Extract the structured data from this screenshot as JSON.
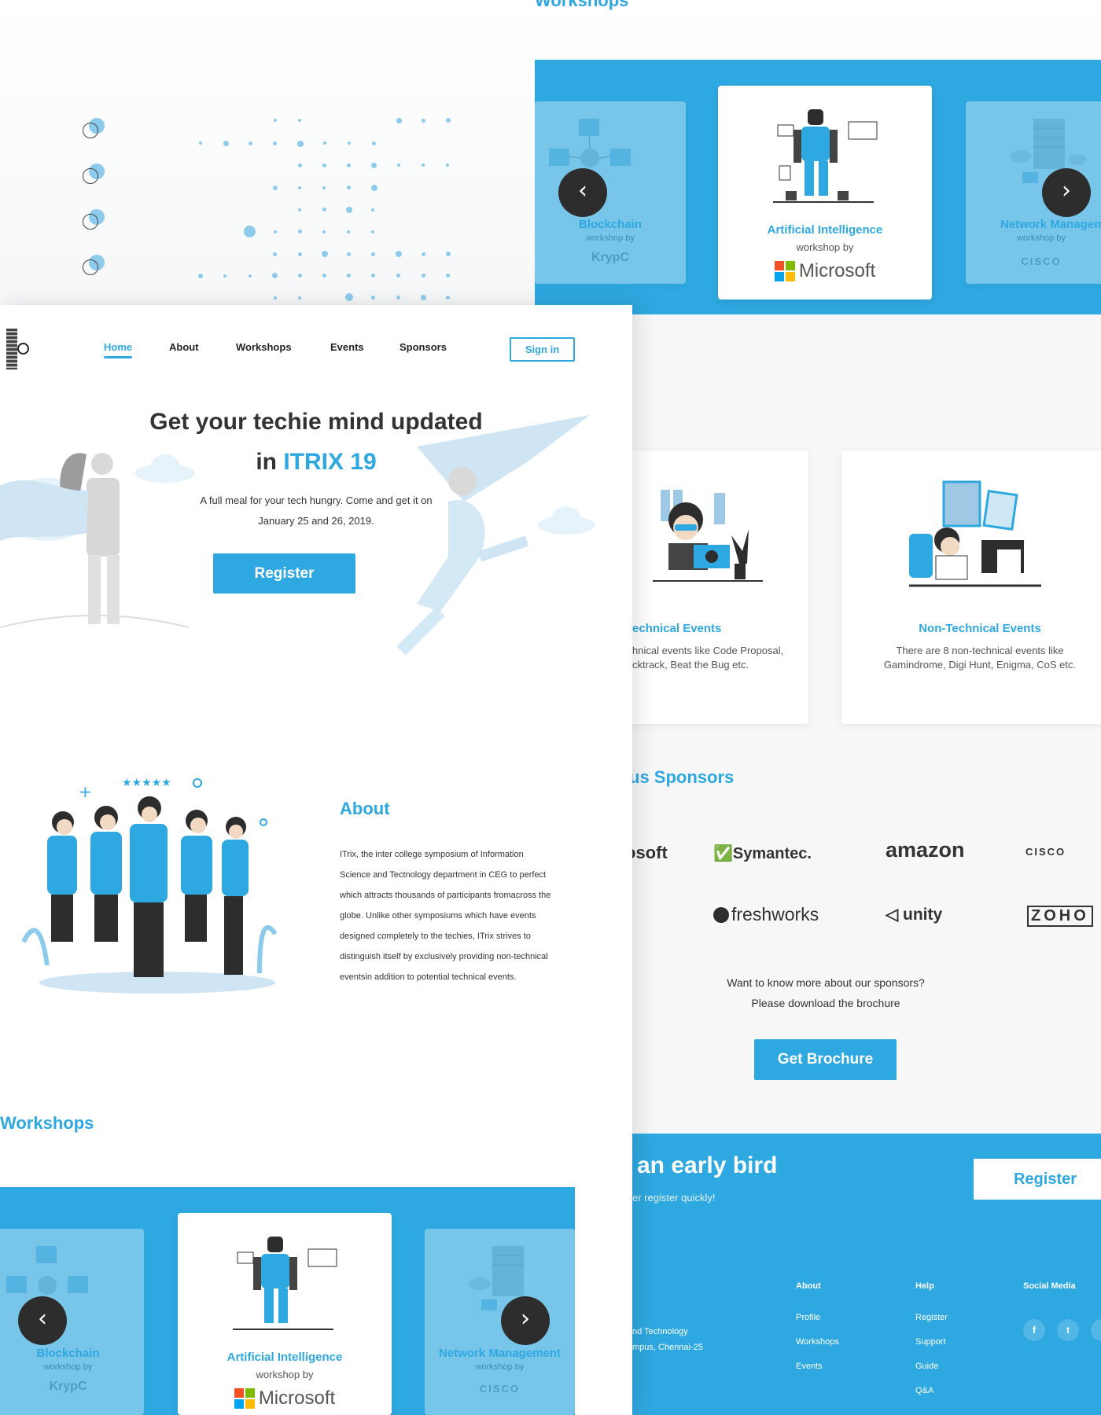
{
  "workshops_top": {
    "partial_heading": "Workshops",
    "cards": [
      {
        "title": "Blockchain",
        "sub": "workshop by",
        "org": "KrypC"
      },
      {
        "title": "Artificial Intelligence",
        "sub": "workshop by",
        "org": "Microsoft"
      },
      {
        "title": "Network Management",
        "sub": "workshop by",
        "org": "CISCO"
      }
    ]
  },
  "nav": {
    "items": [
      "Home",
      "About",
      "Workshops",
      "Events",
      "Sponsors"
    ],
    "signin": "Sign in"
  },
  "hero": {
    "line1": "Get your techie mind updated",
    "line2_prefix": "in ",
    "line2_highlight": "ITRIX 19",
    "desc1": "A full meal for your tech hungry. Come and get it on",
    "desc2": "January  25 and 26, 2019.",
    "register": "Register"
  },
  "about": {
    "title": "About",
    "lines": [
      " ITrix, the inter college symposium of Information",
      "Science and Tectnology department in CEG to perfect",
      "which attracts thousands of participants fromacross the",
      "globe. Unlike other symposiums which have events",
      "designed completely to the techies, ITrix strives to",
      "distinguish itself by exclusively providing non-technical",
      "eventsin addition to potential technical events."
    ]
  },
  "workshops_bottom": {
    "heading": "Workshops",
    "cards": [
      {
        "title": "Blockchain",
        "sub": "workshop by",
        "org": "KrypC"
      },
      {
        "title": "Artificial Intelligence",
        "sub": "workshop by",
        "org": "Microsoft"
      },
      {
        "title": "Network Management",
        "sub": "workshop by",
        "org": "CISCO"
      }
    ]
  },
  "events": {
    "technical": {
      "title": "echnical Events",
      "line1": "hnical events like Code Proposal,",
      "line2": "cktrack, Beat the Bug etc."
    },
    "nontechnical": {
      "title": "Non-Technical Events",
      "line1": "There are 8 non-technical events like",
      "line2": "Gamindrome, Digi Hunt, Enigma, CoS etc."
    }
  },
  "sponsors": {
    "heading": "us Sponsors",
    "row1": [
      "osoft",
      "Symantec.",
      "amazon",
      "CISCO"
    ],
    "row2": [
      "freshworks",
      "unity",
      "ZOHO"
    ],
    "q1": "Want to know more about our sponsors?",
    "q2": "Please download the brochure",
    "button": "Get Brochure"
  },
  "footer": {
    "headline": "an early bird",
    "subline": "er register quickly!",
    "register": "Register",
    "address1": "nd Technology",
    "address2": "mpus, Chennai-25",
    "about": {
      "title": "About",
      "items": [
        "Profile",
        "Workshops",
        "Events"
      ]
    },
    "help": {
      "title": "Help",
      "items": [
        "Register",
        "Support",
        "Guide",
        "Q&A"
      ]
    },
    "social": {
      "title": "Social Media",
      "icons": [
        "f",
        "t"
      ]
    }
  },
  "colors": {
    "accent": "#2ea8e0",
    "dark": "#2d2d2d"
  }
}
